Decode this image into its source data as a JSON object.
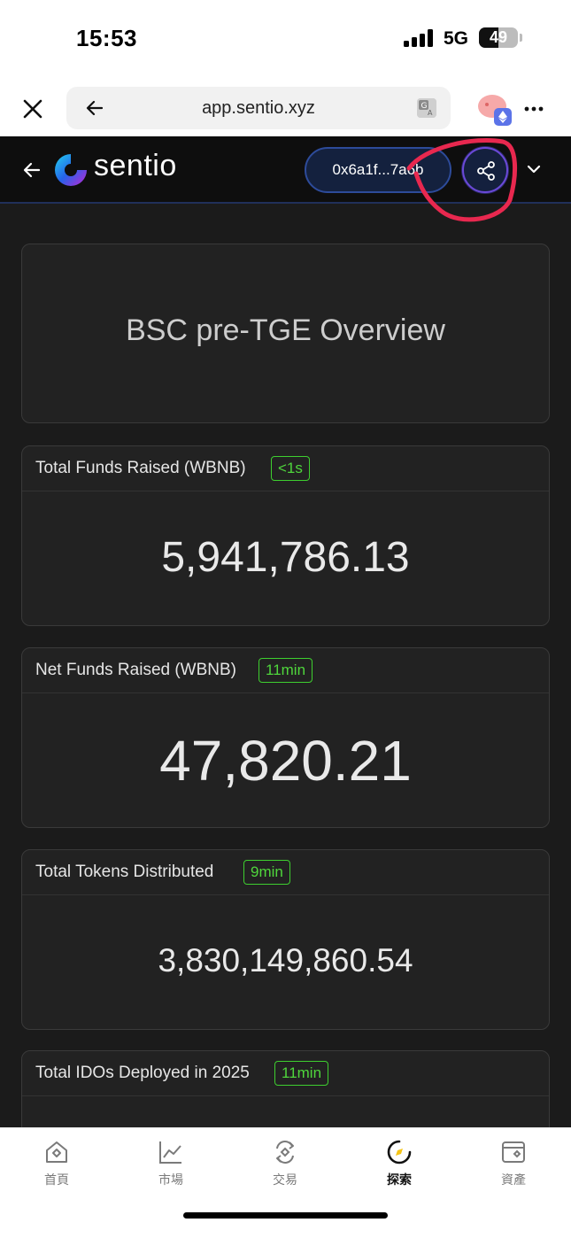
{
  "status_bar": {
    "time": "15:53",
    "network": "5G",
    "battery": "49",
    "battery_level": 0.49
  },
  "browser": {
    "url": "app.sentio.xyz"
  },
  "app_header": {
    "brand": "sentio",
    "address": "0x6a1f...7a6b"
  },
  "dashboard": {
    "title": "BSC pre-TGE Overview",
    "cards": [
      {
        "label": "Total Funds Raised (WBNB)",
        "badge": "<1s",
        "value": "5,941,786.13"
      },
      {
        "label": "Net Funds Raised (WBNB)",
        "badge": "11min",
        "value": "47,820.21"
      },
      {
        "label": "Total Tokens Distributed",
        "badge": "9min",
        "value": "3,830,149,860.54"
      },
      {
        "label": "Total IDOs Deployed in 2025",
        "badge": "11min",
        "value": ""
      }
    ]
  },
  "bottom_nav": {
    "items": [
      {
        "label": "首頁",
        "icon": "home-icon"
      },
      {
        "label": "市場",
        "icon": "chart-icon"
      },
      {
        "label": "交易",
        "icon": "swap-icon"
      },
      {
        "label": "探索",
        "icon": "compass-icon"
      },
      {
        "label": "資產",
        "icon": "wallet-icon"
      }
    ],
    "active": "探索"
  },
  "colors": {
    "accent_green": "#4fd63c",
    "annotation_red": "#e8284f",
    "header_bg": "#0e0e0e",
    "content_bg": "#1b1b1b"
  }
}
